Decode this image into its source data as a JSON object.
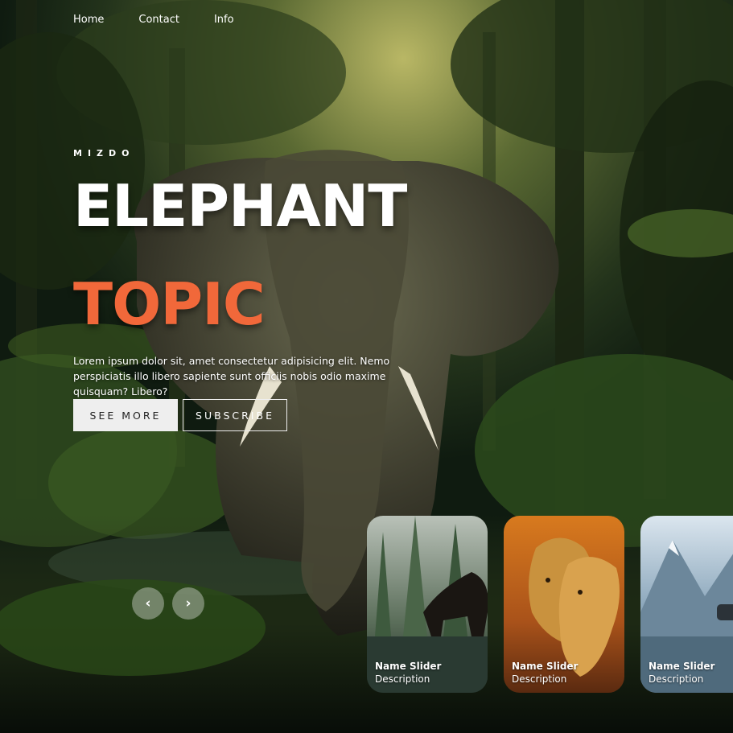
{
  "nav": {
    "items": [
      "Home",
      "Contact",
      "Info"
    ]
  },
  "hero": {
    "author": "MIZDO",
    "title": "ELEPHANT",
    "topic": "TOPIC",
    "description": "Lorem ipsum dolor sit, amet consectetur adipisicing elit. Nemo perspiciatis illo libero sapiente sunt officiis nobis odio maxime quisquam? Libero?",
    "buttons": {
      "primary": "SEE MORE",
      "secondary": "SUBSCRIBE"
    }
  },
  "arrows": {
    "prev": "‹",
    "next": "›"
  },
  "thumbnails": [
    {
      "title": "Name Slider",
      "description": "Description"
    },
    {
      "title": "Name Slider",
      "description": "Description"
    },
    {
      "title": "Name Slider",
      "description": "Description"
    }
  ],
  "colors": {
    "accent": "#f1683a",
    "button_bg": "#eeeeee",
    "text": "#ffffff"
  }
}
